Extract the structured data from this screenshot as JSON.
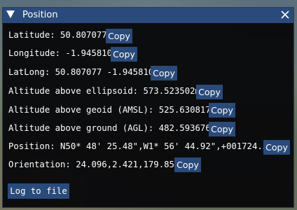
{
  "window": {
    "title": "Position",
    "close_icon": "close-icon",
    "collapse_icon": "triangle-down-icon"
  },
  "rows": [
    {
      "label": "Latitude: 50.807077",
      "copy": "Copy"
    },
    {
      "label": "Longitude: -1.945810",
      "copy": "Copy"
    },
    {
      "label": "LatLong: 50.807077 -1.945810",
      "copy": "Copy"
    },
    {
      "label": "Altitude above ellipsoid: 573.523502m",
      "copy": "Copy"
    },
    {
      "label": "Altitude above geoid (AMSL): 525.630817m",
      "copy": "Copy"
    },
    {
      "label": "Altitude above ground (AGL): 482.593676m",
      "copy": "Copy"
    },
    {
      "label": "Position: N50* 48' 25.48\",W1* 56' 44.92\",+001724.51",
      "copy": "Copy"
    },
    {
      "label": "Orientation: 24.096,2.421,179.858",
      "copy": "Copy"
    }
  ],
  "log_button": "Log to file",
  "colors": {
    "accent": "#294a7a",
    "window_bg": "#08080a",
    "text": "#ffffff"
  }
}
